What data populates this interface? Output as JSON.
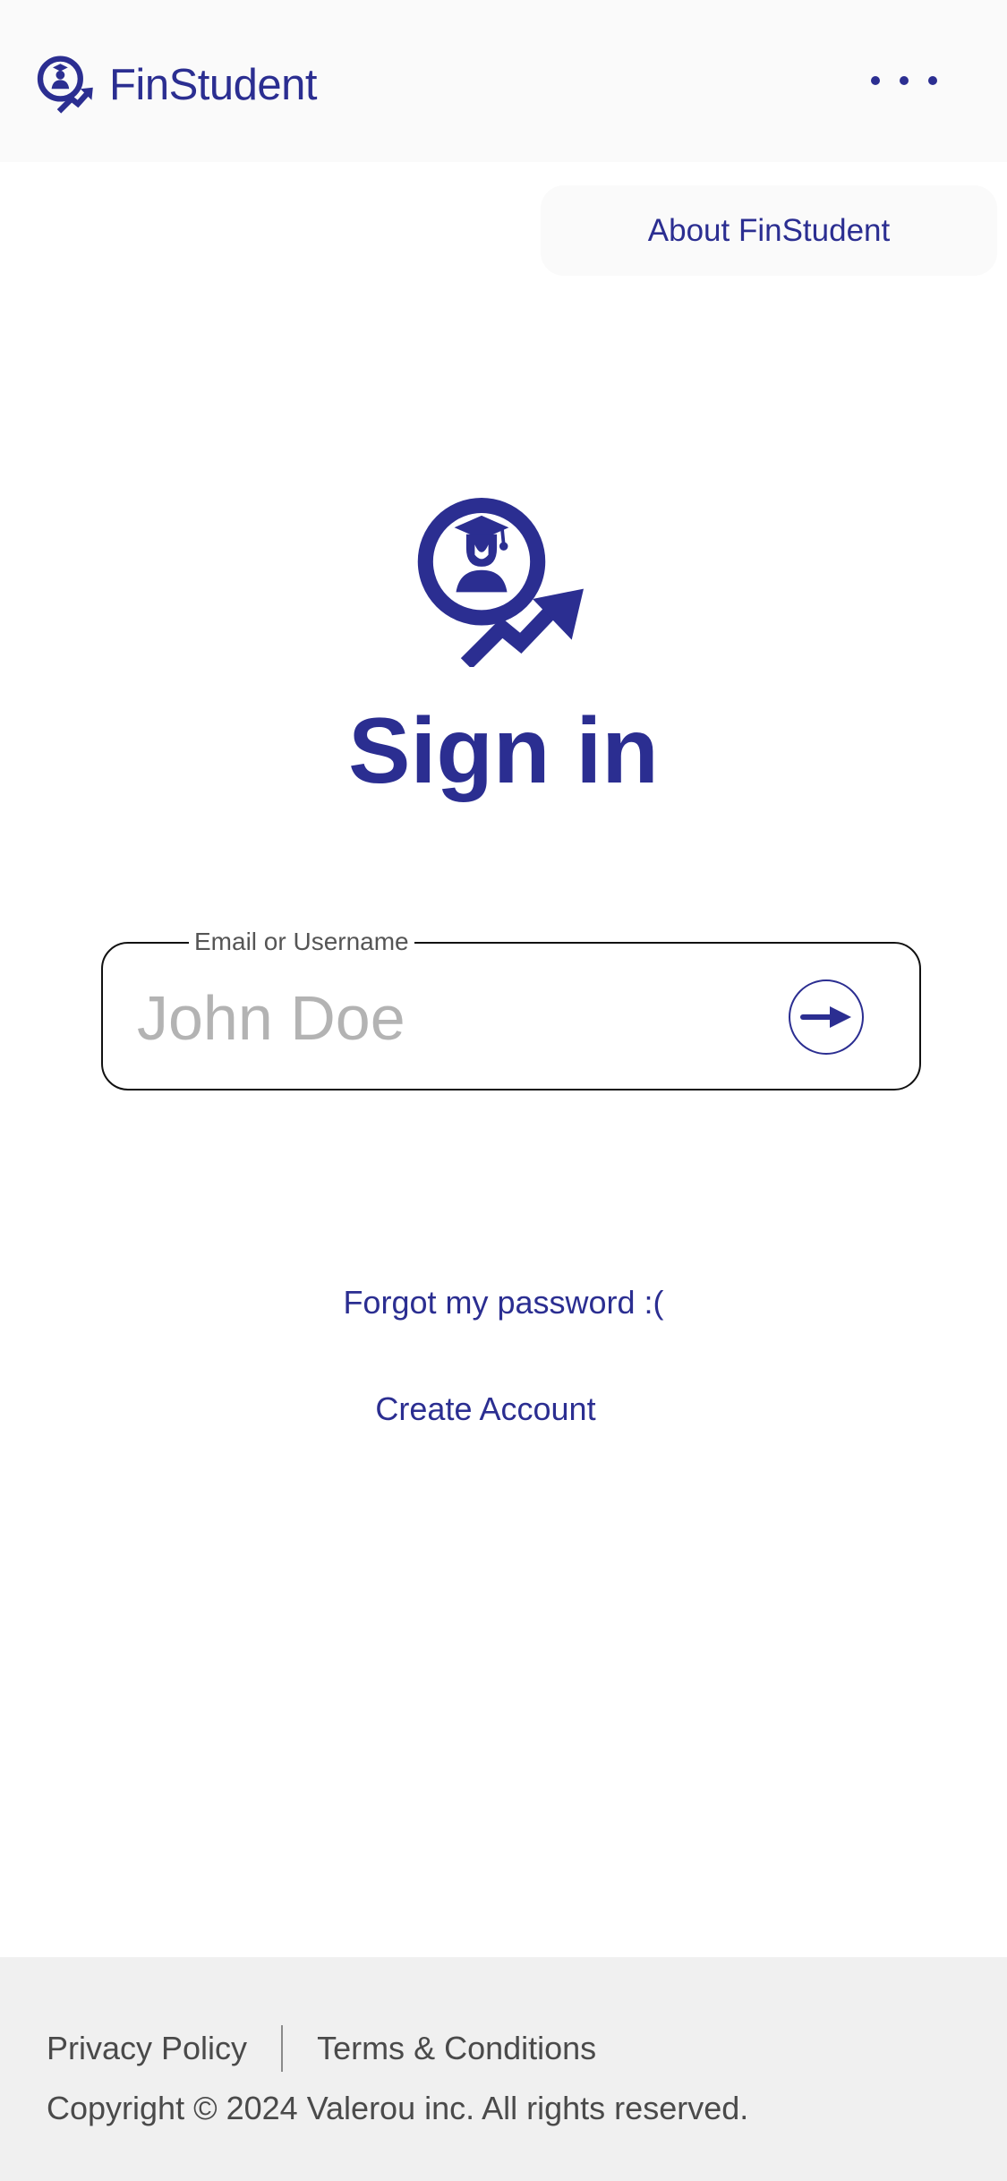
{
  "header": {
    "app_name": "FinStudent",
    "menu_icon": "more-horizontal-icon"
  },
  "about_button": {
    "label": "About FinStudent"
  },
  "main": {
    "logo_icon": "graduate-growth-icon",
    "title": "Sign in"
  },
  "login_field": {
    "label": "Email or Username",
    "placeholder": "John Doe",
    "value": "",
    "submit_icon": "arrow-right-icon"
  },
  "links": {
    "forgot_password": "Forgot my password :(",
    "create_account": "Create Account"
  },
  "footer": {
    "privacy": "Privacy Policy",
    "terms": "Terms & Conditions",
    "copyright": "Copyright © 2024 Valerou inc. All rights reserved."
  },
  "colors": {
    "brand": "#2b2e91",
    "header_bg": "#fafafa",
    "footer_bg": "#f0f0f0",
    "placeholder": "#b3b3b3"
  }
}
